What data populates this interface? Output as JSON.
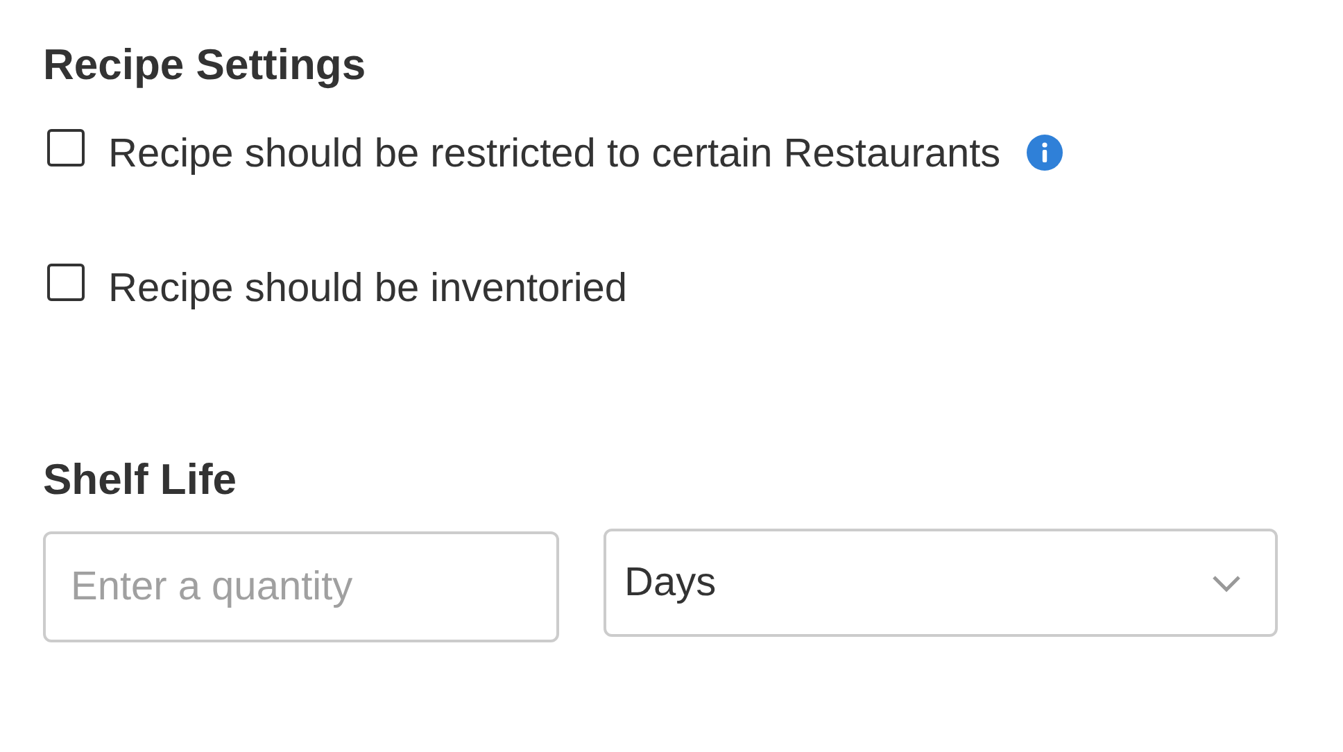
{
  "recipe_settings": {
    "title": "Recipe Settings",
    "options": [
      {
        "label": "Recipe should be restricted to certain Restaurants",
        "checked": false,
        "info": true
      },
      {
        "label": "Recipe should be inventoried",
        "checked": false,
        "info": false
      }
    ]
  },
  "shelf_life": {
    "title": "Shelf Life",
    "quantity": {
      "placeholder": "Enter a quantity"
    },
    "unit": {
      "value": "Days"
    }
  }
}
